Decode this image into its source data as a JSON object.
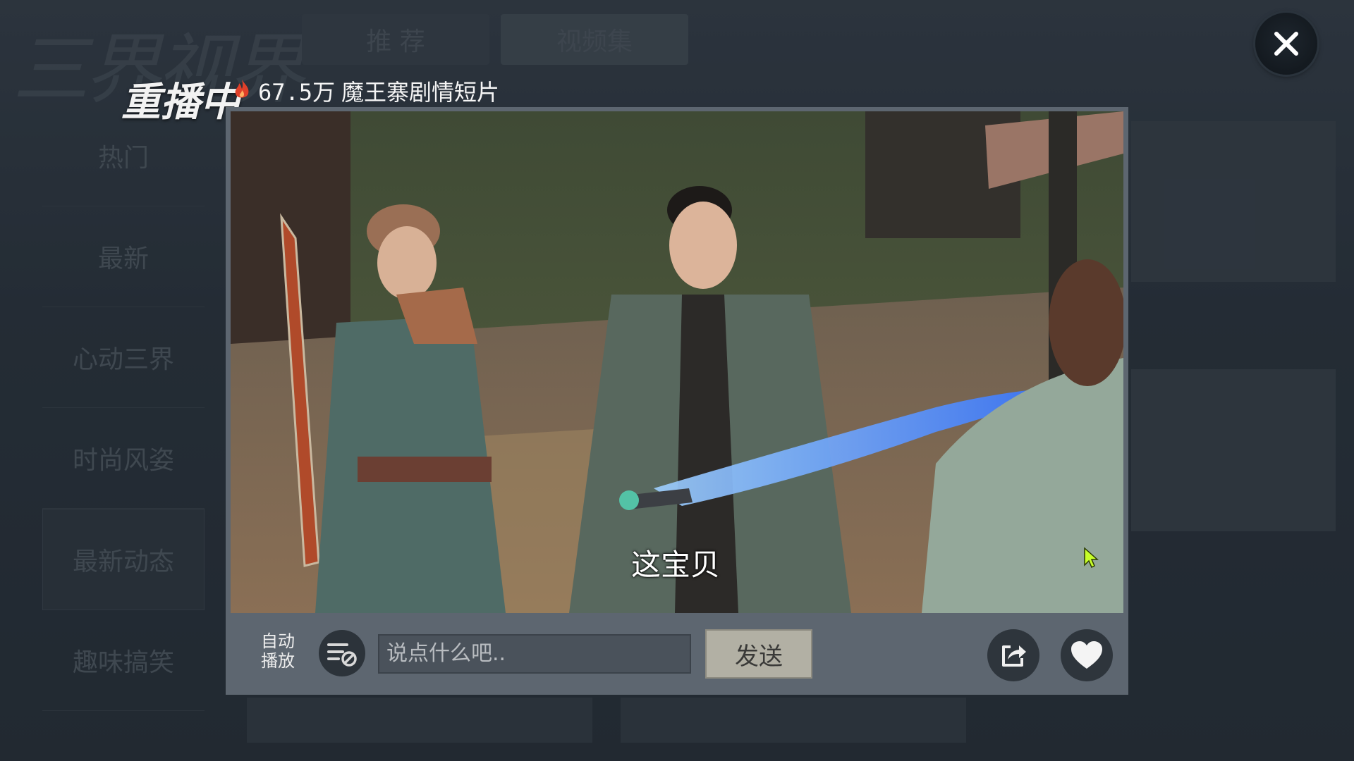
{
  "app": {
    "logo_text": "三界视界"
  },
  "top_tabs": [
    {
      "label": "推 荐"
    },
    {
      "label": "视频集"
    }
  ],
  "sidebar": {
    "items": [
      {
        "label": "热门"
      },
      {
        "label": "最新"
      },
      {
        "label": "心动三界"
      },
      {
        "label": "时尚风姿"
      },
      {
        "label": "最新动态"
      },
      {
        "label": "趣味搞笑"
      }
    ]
  },
  "player": {
    "replay_label": "重播中",
    "view_count": "67.5万",
    "title": "魔王寨剧情短片",
    "subtitle": "这宝贝",
    "auto_play_line1": "自动",
    "auto_play_line2": "播放",
    "comment_placeholder": "说点什么吧..",
    "send_label": "发送"
  },
  "icons": {
    "close": "close-icon",
    "fire": "fire-icon",
    "playlist": "playlist-icon",
    "share": "share-icon",
    "like": "heart-icon",
    "cursor": "cursor-icon"
  },
  "colors": {
    "accent_red": "#e0402a",
    "send_button": "#b2b0a4",
    "panel": "#5d6670"
  }
}
